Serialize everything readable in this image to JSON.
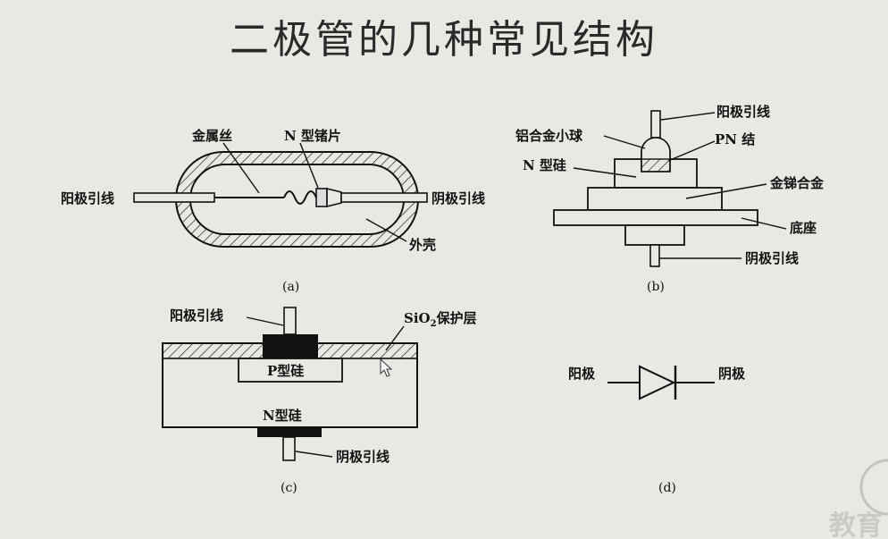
{
  "title": "二极管的几种常见结构",
  "diagram_a": {
    "caption": "(a)",
    "labels": {
      "gold_wire": "金属丝",
      "n_germanium": "N 型锗片",
      "anode_lead": "阳极引线",
      "cathode_lead": "阴极引线",
      "shell": "外壳"
    }
  },
  "diagram_b": {
    "caption": "(b)",
    "labels": {
      "anode_lead": "阳极引线",
      "al_ball": "铝合金小球",
      "pn_junction": "PN 结",
      "n_silicon": "N 型硅",
      "au_sb_alloy": "金锑合金",
      "base": "底座",
      "cathode_lead": "阴极引线"
    }
  },
  "diagram_c": {
    "caption": "(c)",
    "labels": {
      "anode_lead": "阳极引线",
      "sio2_prefix": "SiO",
      "sio2_sub": "2",
      "sio2_suffix": "保护层",
      "p_silicon": "P型硅",
      "n_silicon": "N型硅",
      "cathode_lead": "阴极引线"
    }
  },
  "diagram_d": {
    "caption": "(d)",
    "labels": {
      "anode": "阳极",
      "cathode": "阴极"
    }
  },
  "watermark": "教育"
}
